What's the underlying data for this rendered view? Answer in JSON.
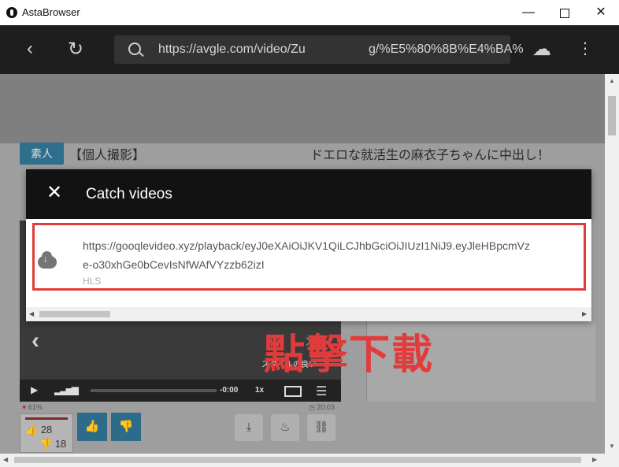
{
  "window": {
    "title": "AstaBrowser",
    "minimize": "—",
    "close": "✕"
  },
  "toolbar": {
    "back": "‹",
    "reload": "↻",
    "url_left": "https://avgle.com/video/Zu",
    "url_right": "g/%E5%80%8B%E4%BA%",
    "download": "☁",
    "menu": "⋮"
  },
  "page": {
    "tag": "素人",
    "title_left": "【個人撮影】",
    "title_right": "ドエロな就活生の麻衣子ちゃんに中出し！",
    "video_subtitle": "スタイルの良い",
    "player": {
      "play": "▶",
      "volume": "▂▃▅▆",
      "time": "-0:00",
      "speed": "1x",
      "list": "☰"
    },
    "rating": "61%",
    "duration": "20:03",
    "up_count": "28",
    "down_count": "18",
    "up_icon": "👍",
    "down_icon": "👎",
    "action_icons": [
      "⤓",
      "♨",
      "⛓"
    ]
  },
  "dialog": {
    "title": "Catch videos",
    "close": "✕",
    "item": {
      "url_line1": "https://gooqlevideo.xyz/playback/eyJ0eXAiOiJKV1QiLCJhbGciOiJIUzI1NiJ9.eyJleHBpcmVz",
      "url_line2": "e-o30xhGe0bCevIsNfWAfVYzzb62izI",
      "type": "HLS"
    }
  },
  "annotation": "點擊下載",
  "colors": {
    "highlight": "#e23b3b",
    "toolbar": "#1e1e1e",
    "dialog_header": "#121212"
  }
}
